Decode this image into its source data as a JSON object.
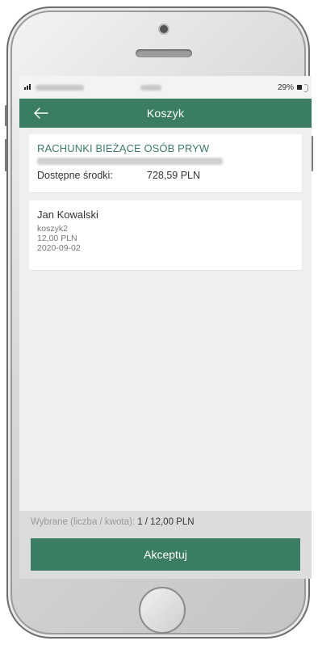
{
  "status_bar": {
    "battery_text": "29%"
  },
  "header": {
    "title": "Koszyk",
    "back_icon": "arrow-left-icon"
  },
  "account": {
    "name": "RACHUNKI BIEŻĄCE OSÓB PRYW",
    "funds_label": "Dostępne środki:",
    "funds_value": "728,59 PLN"
  },
  "transfer": {
    "name": "Jan Kowalski",
    "title": "koszyk2",
    "amount": "12,00 PLN",
    "date": "2020-09-02"
  },
  "footer": {
    "selected_label": "Wybrane (liczba / kwota):",
    "selected_value": "1 / 12,00 PLN",
    "accept_label": "Akceptuj"
  },
  "colors": {
    "brand_green": "#3b7d63",
    "screen_bg": "#efefef",
    "footer_bg": "#dcdcdc"
  }
}
